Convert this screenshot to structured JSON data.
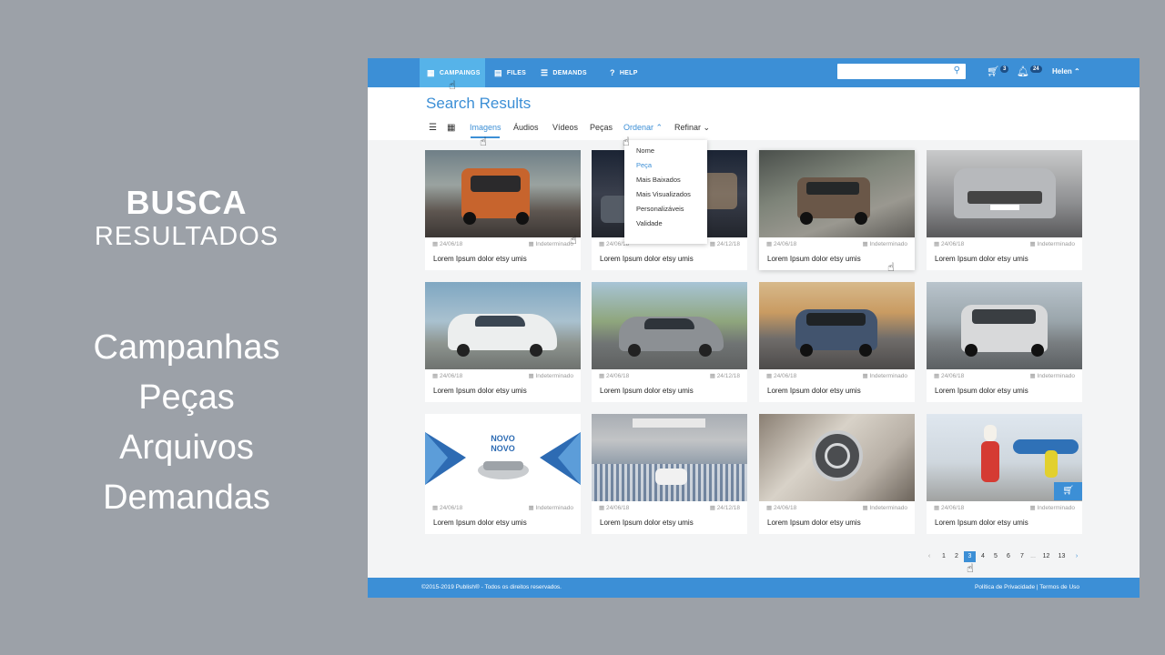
{
  "promo": {
    "title": "BUSCA",
    "subtitle": "RESULTADOS",
    "list": [
      "Campanhas",
      "Peças",
      "Arquivos",
      "Demandas"
    ]
  },
  "topbar": {
    "nav": [
      {
        "label": "CAMPAINGS",
        "icon": "calendar-icon"
      },
      {
        "label": "FILES",
        "icon": "files-icon"
      },
      {
        "label": "DEMANDS",
        "icon": "list-icon"
      },
      {
        "label": "HELP",
        "icon": "help-icon"
      }
    ],
    "search_value": "",
    "cart_count": "3",
    "notif_count": "24",
    "user": "Helen"
  },
  "page": {
    "title": "Search Results",
    "tabs": [
      "Imagens",
      "Áudios",
      "Vídeos",
      "Peças"
    ],
    "sort_label": "Ordenar",
    "refine_label": "Refinar"
  },
  "sort_options": [
    "Nome",
    "Peça",
    "Mais Baixados",
    "Mais Visualizados",
    "Personalizáveis",
    "Validade"
  ],
  "cards": [
    {
      "date": "24/06/18",
      "validity": "Indeterminado",
      "title": "Lorem Ipsum dolor etsy umis"
    },
    {
      "date": "24/06/18",
      "validity": "24/12/18",
      "title": "Lorem Ipsum dolor etsy umis"
    },
    {
      "date": "24/06/18",
      "validity": "Indeterminado",
      "title": "Lorem Ipsum dolor etsy umis"
    },
    {
      "date": "24/06/18",
      "validity": "Indeterminado",
      "title": "Lorem Ipsum dolor etsy umis"
    },
    {
      "date": "24/06/18",
      "validity": "Indeterminado",
      "title": "Lorem Ipsum dolor etsy umis"
    },
    {
      "date": "24/06/18",
      "validity": "24/12/18",
      "title": "Lorem Ipsum dolor etsy umis"
    },
    {
      "date": "24/06/18",
      "validity": "Indeterminado",
      "title": "Lorem Ipsum dolor etsy umis"
    },
    {
      "date": "24/06/18",
      "validity": "Indeterminado",
      "title": "Lorem Ipsum dolor etsy umis"
    },
    {
      "date": "24/06/18",
      "validity": "Indeterminado",
      "title": "Lorem Ipsum dolor etsy umis",
      "image_text": [
        "NOVO",
        "NOVO"
      ]
    },
    {
      "date": "24/06/18",
      "validity": "24/12/18",
      "title": "Lorem Ipsum dolor etsy umis"
    },
    {
      "date": "24/06/18",
      "validity": "Indeterminado",
      "title": "Lorem Ipsum dolor etsy umis"
    },
    {
      "date": "24/06/18",
      "validity": "Indeterminado",
      "title": "Lorem Ipsum dolor etsy umis"
    }
  ],
  "pagination": {
    "items": [
      "1",
      "2",
      "3",
      "4",
      "5",
      "6",
      "7",
      "...",
      "12",
      "13"
    ],
    "current": "3"
  },
  "footer": {
    "copyright": "©2015-2019 Publish® - Todos os direitos reservados.",
    "links": "Política de Privacidade | Termos de Uso"
  },
  "colors": {
    "background": "#9ca1a8",
    "primary": "#3c8fd6",
    "active_nav": "#56b3e9"
  }
}
